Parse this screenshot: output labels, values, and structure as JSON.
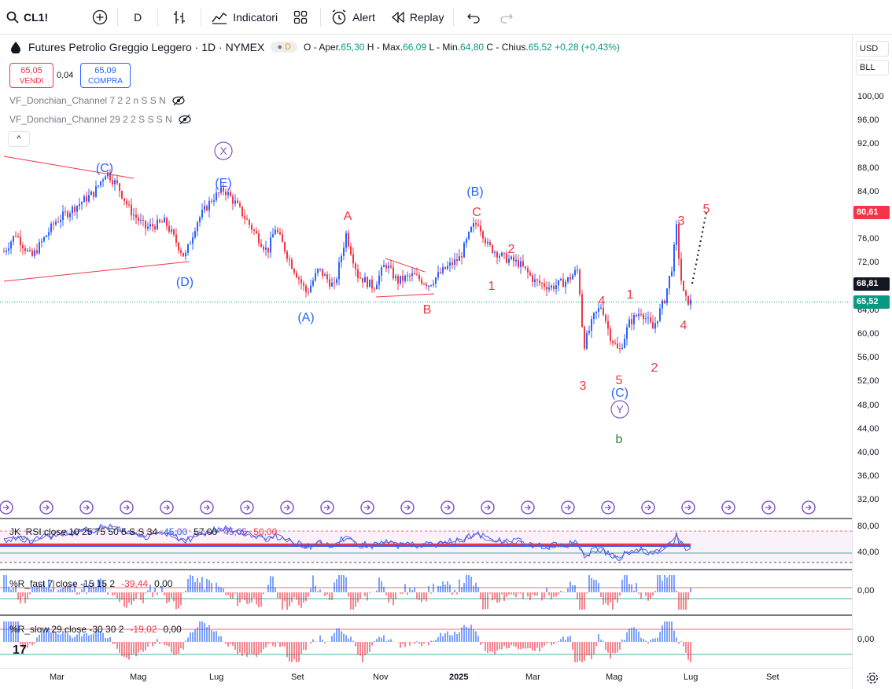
{
  "toolbar": {
    "symbol": "CL1!",
    "interval": "D",
    "indicators_label": "Indicatori",
    "alert_label": "Alert",
    "replay_label": "Replay"
  },
  "legend": {
    "title": "Futures Petrolio Greggio Leggero · 1D · NYMEX",
    "badge": "D",
    "o_label": "O - Aper.",
    "o": "65,30",
    "h_label": "H - Max.",
    "h": "66,09",
    "l_label": "L - Min.",
    "l": "64,80",
    "c_label": "C - Chius.",
    "c": "65,52",
    "change": "+0,28 (+0,43%)"
  },
  "trade": {
    "sell_price": "65,05",
    "sell_label": "VENDI",
    "spread": "0,04",
    "buy_price": "65,09",
    "buy_label": "COMPRA"
  },
  "indicators": [
    "VF_Donchian_Channel 7 2 2 n S S N",
    "VF_Donchian_Channel 29 2 2 S S S N"
  ],
  "collapse_label": "^",
  "price_scale": {
    "currency": "USD",
    "unit": "BLL",
    "ticks": [
      "100,00",
      "96,00",
      "92,00",
      "88,00",
      "84,00",
      "80,00",
      "76,00",
      "72,00",
      "68,00",
      "64,00",
      "60,00",
      "56,00",
      "52,00",
      "48,00",
      "44,00",
      "40,00",
      "36,00",
      "32,00"
    ],
    "tag_red": "80,61",
    "tag_dark": "68,81",
    "tag_green": "65,52"
  },
  "wave_labels": {
    "C_paren_1": "(C)",
    "X_circ": "X",
    "E_paren": "(E)",
    "D_paren": "(D)",
    "A_paren": "(A)",
    "A": "A",
    "B": "B",
    "B_paren": "(B)",
    "C": "C",
    "one_a": "1",
    "two_a": "2",
    "three_a": "3",
    "four_a": "4",
    "five_a": "5",
    "C_paren_2": "(C)",
    "Y_circ": "Y",
    "b_green": "b",
    "one_b": "1",
    "two_b": "2",
    "three_b": "3",
    "four_b": "4",
    "five_b": "5"
  },
  "rsi": {
    "label": "JK_RSI close 10 25 75 50 5 S S 34",
    "v1": "45,00",
    "v2": "57,00",
    "v3": "45,05",
    "v4": "50,00",
    "ticks": [
      "80,00",
      "40,00"
    ]
  },
  "rfast": {
    "label": "%R_fast 7 close -15 15 2",
    "v1": "-39,44",
    "v2": "0,00",
    "tick": "0,00"
  },
  "rslow": {
    "label": "%R_slow 29 close -30 30 2",
    "v1": "-19,02",
    "v2": "0,00",
    "tick": "0,00"
  },
  "xaxis": [
    "Mar",
    "Mag",
    "Lug",
    "Set",
    "Nov",
    "2025",
    "Mar",
    "Mag",
    "Lug",
    "Set"
  ],
  "colors": {
    "up": "#2962ff",
    "down": "#f23645",
    "green": "#089981",
    "wave_blue": "#2962ff",
    "wave_red": "#f23645",
    "wave_green": "#2e7d32",
    "purple": "#7e57c2"
  }
}
